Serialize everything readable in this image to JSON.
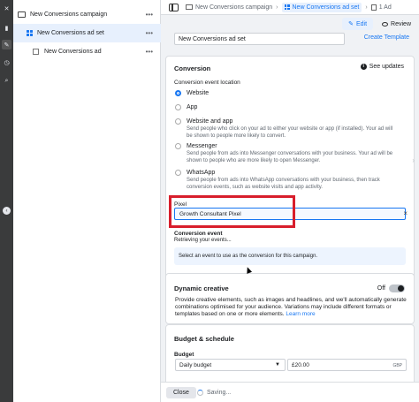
{
  "tree": {
    "campaign": "New Conversions campaign",
    "adset": "New Conversions ad set",
    "ad": "New Conversions ad",
    "more": "•••"
  },
  "breadcrumb": {
    "campaign": "New Conversions campaign",
    "adset": "New Conversions ad set",
    "ad": "1 Ad",
    "sep": "›"
  },
  "header": {
    "edit_label": "Edit",
    "review_label": "Review",
    "adset_name": "New Conversions ad set",
    "create_template": "Create Template"
  },
  "conversion": {
    "title": "Conversion",
    "see_updates": "See updates",
    "location_label": "Conversion event location",
    "options": [
      {
        "label": "Website",
        "desc": "",
        "selected": true
      },
      {
        "label": "App",
        "desc": "",
        "selected": false
      },
      {
        "label": "Website and app",
        "desc": "Send people who click on your ad to either your website or app (if installed). Your ad will be shown to people more likely to convert.",
        "selected": false
      },
      {
        "label": "Messenger",
        "desc": "Send people from ads into Messenger conversations with your business. Your ad will be shown to people who are more likely to open Messenger.",
        "selected": false
      },
      {
        "label": "WhatsApp",
        "desc": "Send people from ads into WhatsApp conversations with your business, then track conversion events, such as website visits and app activity.",
        "selected": false
      }
    ],
    "pixel_label": "Pixel",
    "pixel_value": "Growth Consultant Pixel",
    "pixel_clear": "×",
    "event_label": "Conversion event",
    "event_status": "Retrieving your events...",
    "event_info": "Select an event to use as the conversion for this campaign."
  },
  "dynamic_creative": {
    "title": "Dynamic creative",
    "toggle_label": "Off",
    "desc": "Provide creative elements, such as images and headlines, and we'll automatically generate combinations optimised for your audience. Variations may include different formats or templates based on one or more elements.",
    "learn_more": "Learn more"
  },
  "budget": {
    "title": "Budget & schedule",
    "label": "Budget",
    "type": "Daily budget",
    "amount": "£20.00",
    "currency": "GBP"
  },
  "footer": {
    "close_label": "Close",
    "saving_label": "Saving..."
  }
}
